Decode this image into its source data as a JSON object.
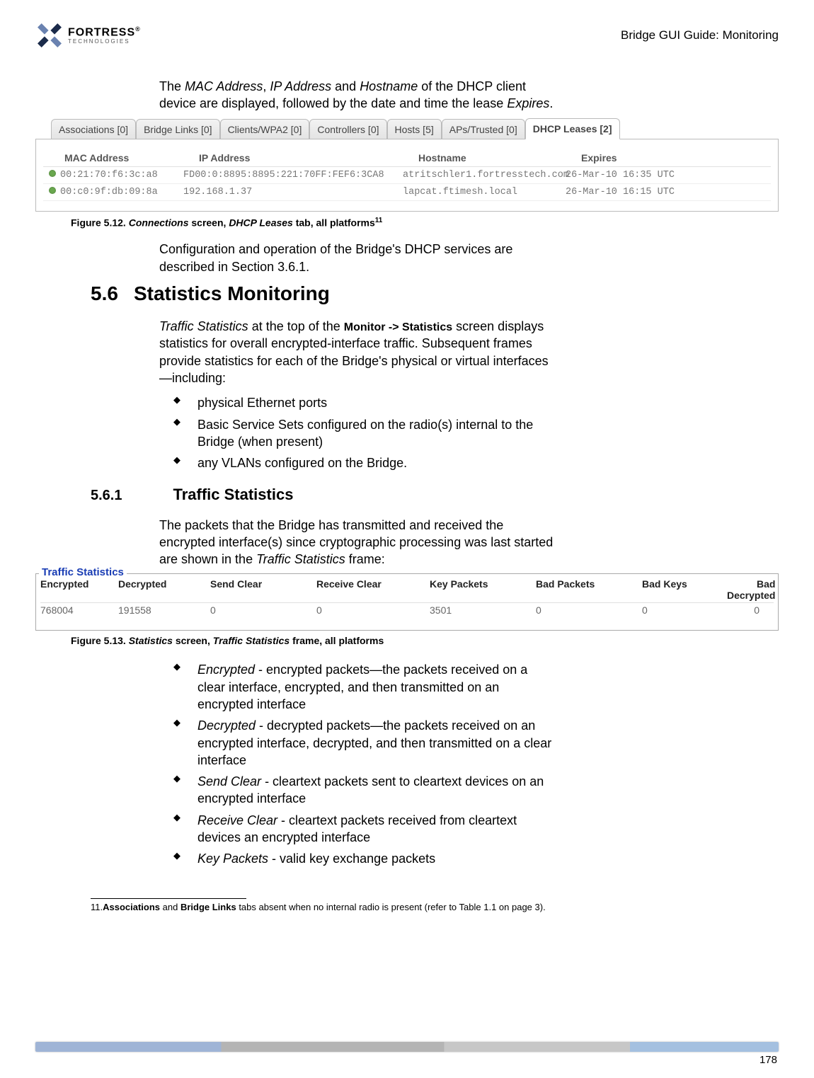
{
  "header": {
    "logo_brand": "FORTRESS",
    "logo_r": "®",
    "logo_sub": "TECHNOLOGIES",
    "title": "Bridge GUI Guide: Monitoring"
  },
  "intro_para_pre": "The ",
  "intro_mac": "MAC Address",
  "intro_sep1": ", ",
  "intro_ip": "IP Address",
  "intro_and": " and ",
  "intro_host": "Hostname",
  "intro_rest": " of the DHCP client device are displayed, followed by the date and time the lease ",
  "intro_expires": "Expires",
  "intro_dot": ".",
  "tabs": [
    {
      "label": "Associations [0]"
    },
    {
      "label": "Bridge Links [0]"
    },
    {
      "label": "Clients/WPA2 [0]"
    },
    {
      "label": "Controllers [0]"
    },
    {
      "label": "Hosts [5]"
    },
    {
      "label": "APs/Trusted [0]"
    },
    {
      "label": "DHCP Leases [2]"
    }
  ],
  "dhcp_cols": {
    "mac": "MAC Address",
    "ip": "IP Address",
    "host": "Hostname",
    "exp": "Expires"
  },
  "dhcp_rows": [
    {
      "mac": "00:21:70:f6:3c:a8",
      "ip": "FD00:0:8895:8895:221:70FF:FEF6:3CA8",
      "host": "atritschler1.fortresstech.com",
      "exp": "26-Mar-10 16:35 UTC"
    },
    {
      "mac": "00:c0:9f:db:09:8a",
      "ip": "192.168.1.37",
      "host": "lapcat.ftimesh.local",
      "exp": "26-Mar-10 16:15 UTC"
    }
  ],
  "fig512_pre": "Figure 5.12. ",
  "fig512_a": "Connections",
  "fig512_mid": " screen, ",
  "fig512_b": "DHCP Leases",
  "fig512_end": " tab, all platforms",
  "fig512_sup": "11",
  "para_config": "Configuration and operation of the Bridge's DHCP services are described in Section 3.6.1.",
  "sec_num": "5.6",
  "sec_title": "Statistics Monitoring",
  "stats_para_a": "Traffic Statistics",
  "stats_para_b": " at the top of the ",
  "stats_para_c": "Monitor -> Statistics",
  "stats_para_d": " screen displays statistics for overall encrypted-interface traffic. Subsequent frames provide statistics for each of the Bridge's physical or virtual interfaces—including:",
  "bullets1": [
    "physical Ethernet ports",
    "Basic Service Sets configured on the radio(s) internal to the Bridge (when present)",
    "any VLANs configured on the Bridge."
  ],
  "sub_num": "5.6.1",
  "sub_title": "Traffic Statistics",
  "ts_para_a": "The packets that the Bridge has transmitted and received the encrypted interface(s) since cryptographic processing was last started are shown in the ",
  "ts_para_b": "Traffic Statistics",
  "ts_para_c": " frame:",
  "ts_legend": "Traffic Statistics",
  "ts_cols": [
    "Encrypted",
    "Decrypted",
    "Send Clear",
    "Receive Clear",
    "Key Packets",
    "Bad Packets",
    "Bad Keys",
    "Bad Decrypted"
  ],
  "ts_vals": [
    "768004",
    "191558",
    "0",
    "0",
    "3501",
    "0",
    "0",
    "0"
  ],
  "fig513_pre": "Figure 5.13. ",
  "fig513_a": "Statistics",
  "fig513_mid": " screen, ",
  "fig513_b": "Traffic Statistics",
  "fig513_end": " frame, all platforms",
  "defs": [
    {
      "term": "Encrypted",
      "desc": " - encrypted packets—the packets received on a clear interface, encrypted, and then transmitted on an encrypted interface"
    },
    {
      "term": "Decrypted",
      "desc": " - decrypted packets—the packets received on an encrypted interface, decrypted, and then transmitted on a clear interface"
    },
    {
      "term": "Send Clear",
      "desc": " - cleartext packets sent to cleartext devices on an encrypted interface"
    },
    {
      "term": "Receive Clear",
      "desc": " - cleartext packets received from cleartext devices an encrypted interface"
    },
    {
      "term": "Key Packets",
      "desc": " - valid key exchange packets"
    }
  ],
  "footnote_num": "11.",
  "footnote_a": "Associations",
  "footnote_mid": " and ",
  "footnote_b": "Bridge Links",
  "footnote_end": " tabs absent when no internal radio is present (refer to Table 1.1 on page 3).",
  "page_num": "178",
  "chart_data": {
    "type": "table",
    "title": "Traffic Statistics",
    "columns": [
      "Encrypted",
      "Decrypted",
      "Send Clear",
      "Receive Clear",
      "Key Packets",
      "Bad Packets",
      "Bad Keys",
      "Bad Decrypted"
    ],
    "rows": [
      [
        768004,
        191558,
        0,
        0,
        3501,
        0,
        0,
        0
      ]
    ]
  }
}
